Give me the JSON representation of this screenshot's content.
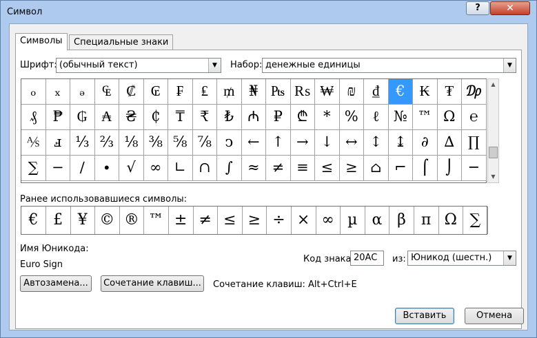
{
  "window": {
    "title": "Символ",
    "help": "?",
    "close": "✕"
  },
  "tabs": [
    "Символы",
    "Специальные знаки"
  ],
  "font": {
    "label": "Шрифт:",
    "value": "(обычный текст)"
  },
  "subset": {
    "label": "Набор:",
    "value": "денежные единицы"
  },
  "symbols": [
    [
      "ₒ",
      "ₓ",
      "ₔ",
      "₠",
      "₡",
      "₢",
      "₣",
      "₤",
      "₥",
      "₦",
      "₧",
      "₨",
      "₩",
      "₪",
      "₫",
      "€",
      "₭",
      "₮",
      "₯"
    ],
    [
      "₰",
      "₱",
      "₲",
      "₳",
      "₴",
      "₵",
      "₸",
      "₹",
      "₺",
      "₼",
      "₽",
      "₾",
      "*",
      "%",
      "ℓ",
      "№",
      "™",
      "Ω",
      "℮"
    ],
    [
      "⅍",
      "ⅎ",
      "⅓",
      "⅔",
      "⅛",
      "⅜",
      "⅝",
      "⅞",
      "ↄ",
      "←",
      "↑",
      "→",
      "↓",
      "↔",
      "↕",
      "↨",
      "∂",
      "∆",
      "∏"
    ],
    [
      "∑",
      "−",
      "∕",
      "∙",
      "√",
      "∞",
      "∟",
      "∩",
      "∫",
      "≈",
      "≠",
      "≡",
      "≤",
      "≥",
      "⌂",
      "⌐",
      "⌠",
      "⌡",
      "─"
    ]
  ],
  "selected": {
    "row": 0,
    "col": 15
  },
  "recent_label": "Ранее использовавшиеся символы:",
  "recent": [
    "€",
    "£",
    "¥",
    "©",
    "®",
    "™",
    "±",
    "≠",
    "≤",
    "≥",
    "÷",
    "×",
    "∞",
    "µ",
    "α",
    "β",
    "π",
    "Ω",
    "∑"
  ],
  "unicode_name_label": "Имя Юникода:",
  "unicode_name": "Euro Sign",
  "code_label": "Код знака:",
  "code_value": "20AC",
  "from_label": "из:",
  "from_value": "Юникод (шестн.)",
  "autocorrect_button": "Автозамена...",
  "shortcut_button": "Сочетание клавиш...",
  "shortcut_text": "Сочетание клавиш: Alt+Ctrl+E",
  "insert_button": "Вставить",
  "cancel_button": "Отмена"
}
